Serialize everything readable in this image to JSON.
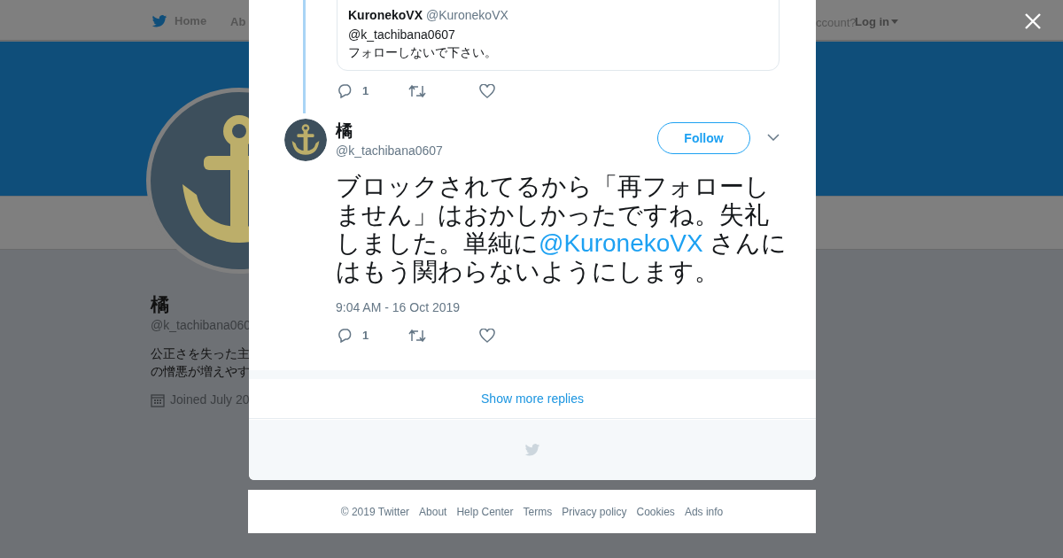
{
  "background": {
    "nav": {
      "home": "Home",
      "about": "Ab",
      "login_prompt": "ccount?",
      "login": "Log in"
    },
    "profile": {
      "name": "橘",
      "handle": "@k_tachibana060",
      "bio": [
        "公正さを失った主",
        "の憎悪が増えやす"
      ],
      "joined": "Joined July 20"
    }
  },
  "modal": {
    "quoted_tweet": {
      "name": "KuronekoVX",
      "handle": "@KuronekoVX",
      "reply_to": "@k_tachibana0607",
      "text": "フォローしないで下さい。"
    },
    "parent_actions": {
      "replies": "1"
    },
    "tweet": {
      "name": "橘",
      "handle": "@k_tachibana0607",
      "follow": "Follow",
      "parts": [
        {
          "kind": "text",
          "text": "ブロックされてるから「再フォローしません」はおかしかったですね。失礼しました。単純に"
        },
        {
          "kind": "mention",
          "text": "@KuronekoVX"
        },
        {
          "kind": "text",
          "text": " さんにはもう関わらないようにします。"
        }
      ],
      "time": "9:04 AM - 16 Oct 2019",
      "replies": "1"
    },
    "show_more": "Show more replies"
  },
  "footer": [
    "© 2019 Twitter",
    "About",
    "Help Center",
    "Terms",
    "Privacy policy",
    "Cookies",
    "Ads info"
  ]
}
